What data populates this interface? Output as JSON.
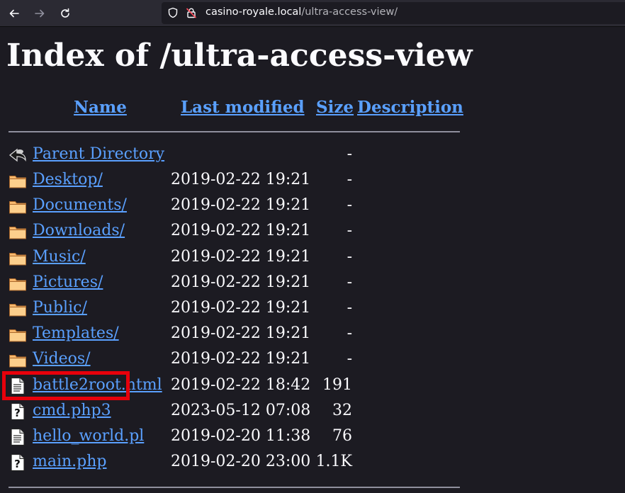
{
  "browser": {
    "url_host": "casino-royale.local",
    "url_path": "/ultra-access-view/"
  },
  "page": {
    "title": "Index of /ultra-access-view",
    "columns": {
      "name": "Name",
      "last_modified": "Last modified",
      "size": "Size",
      "description": "Description"
    },
    "parent": {
      "name": "Parent Directory",
      "size": "-"
    },
    "entries": [
      {
        "name": "Desktop/",
        "date": "2019-02-22 19:21",
        "size": "-",
        "icon": "folder-icon"
      },
      {
        "name": "Documents/",
        "date": "2019-02-22 19:21",
        "size": "-",
        "icon": "folder-icon"
      },
      {
        "name": "Downloads/",
        "date": "2019-02-22 19:21",
        "size": "-",
        "icon": "folder-icon"
      },
      {
        "name": "Music/",
        "date": "2019-02-22 19:21",
        "size": "-",
        "icon": "folder-icon"
      },
      {
        "name": "Pictures/",
        "date": "2019-02-22 19:21",
        "size": "-",
        "icon": "folder-icon"
      },
      {
        "name": "Public/",
        "date": "2019-02-22 19:21",
        "size": "-",
        "icon": "folder-icon"
      },
      {
        "name": "Templates/",
        "date": "2019-02-22 19:21",
        "size": "-",
        "icon": "folder-icon"
      },
      {
        "name": "Videos/",
        "date": "2019-02-22 19:21",
        "size": "-",
        "icon": "folder-icon"
      },
      {
        "name": "battle2root.html",
        "date": "2019-02-22 18:42",
        "size": "191",
        "icon": "text-file-icon"
      },
      {
        "name": "cmd.php3",
        "date": "2023-05-12 07:08",
        "size": "32",
        "icon": "unknown-file-icon"
      },
      {
        "name": "hello_world.pl",
        "date": "2019-02-20 11:38",
        "size": "76",
        "icon": "text-file-icon"
      },
      {
        "name": "main.php",
        "date": "2019-02-20 23:00",
        "size": "1.1K",
        "icon": "unknown-file-icon"
      }
    ]
  },
  "colors": {
    "link": "#5aa0ff",
    "highlight_box": "#e8000b",
    "background": "#1c1b22"
  }
}
